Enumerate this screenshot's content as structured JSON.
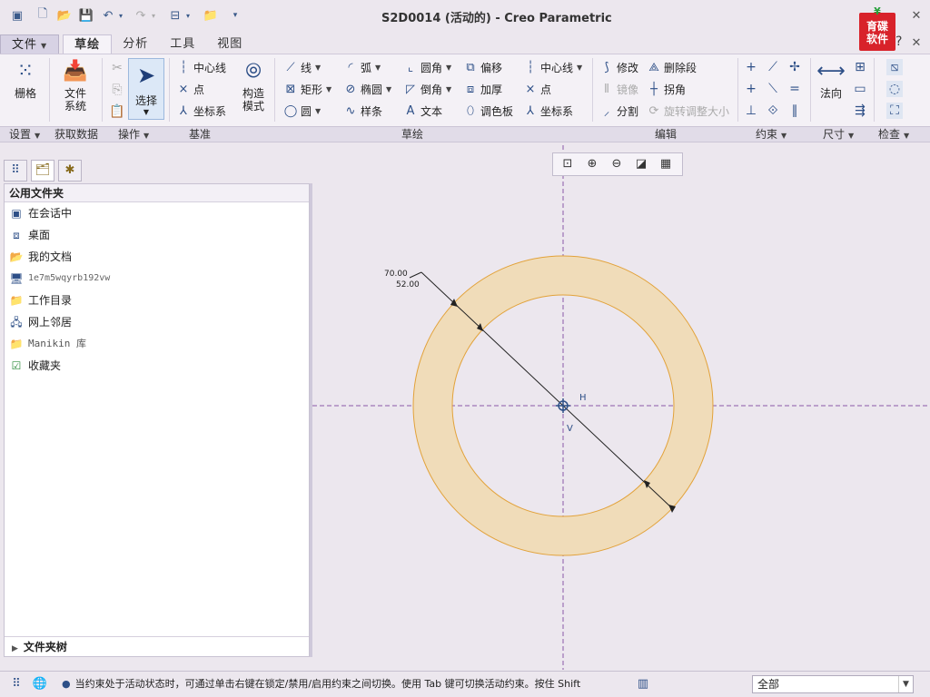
{
  "app": {
    "title": "S2D0014 (活动的) - Creo Parametric",
    "logo_text": "育碟软件",
    "help_glyph": "?"
  },
  "quick_access": [
    "new-icon",
    "open-icon",
    "save-icon",
    "undo-icon",
    "redo-icon",
    "window-icon",
    "folder-icon"
  ],
  "tabs": {
    "file": "文件",
    "items": [
      "草绘",
      "分析",
      "工具",
      "视图"
    ],
    "active": "草绘"
  },
  "ribbon": {
    "settings": {
      "grid": "栅格"
    },
    "data": {
      "file_system": [
        "文件",
        "系统"
      ]
    },
    "operations": {
      "select": "选择"
    },
    "datum": {
      "centerline": "中心线",
      "point": "点",
      "coord_sys": "坐标系",
      "construct_mode": [
        "构造",
        "模式"
      ]
    },
    "sketch": {
      "line": "线",
      "arc": "弧",
      "fillet": "圆角",
      "offset": "偏移",
      "centerline": "中心线",
      "rectangle": "矩形",
      "ellipse": "椭圆",
      "chamfer": "倒角",
      "thicken": "加厚",
      "point": "点",
      "circle": "圆",
      "spline": "样条",
      "text": "文本",
      "palette": "调色板",
      "coord_sys": "坐标系"
    },
    "edit": {
      "modify": "修改",
      "delete_segment": "删除段",
      "mirror": "镜像",
      "corner": "拐角",
      "divide": "分割",
      "rotate_resize": "旋转调整大小"
    },
    "dimension": {
      "normal": "法向"
    },
    "groups": [
      "设置",
      "获取数据",
      "操作",
      "基准",
      "草绘",
      "编辑",
      "约束",
      "尺寸",
      "检查"
    ]
  },
  "left_panel": {
    "header": "公用文件夹",
    "items": [
      {
        "label": "在会话中",
        "icon": "session-icon"
      },
      {
        "label": "桌面",
        "icon": "desktop-icon"
      },
      {
        "label": "我的文档",
        "icon": "documents-icon"
      },
      {
        "label": "1e7m5wqyrb192vw",
        "icon": "computer-icon"
      },
      {
        "label": "工作目录",
        "icon": "working-dir-icon"
      },
      {
        "label": "网上邻居",
        "icon": "network-icon"
      },
      {
        "label": "Manikin 库",
        "icon": "library-icon"
      },
      {
        "label": "收藏夹",
        "icon": "favorites-icon"
      }
    ],
    "tree": "文件夹树"
  },
  "canvas": {
    "dimension_outer": "70.00",
    "dimension_inner": "52.00",
    "label_h": "H",
    "label_v": "V",
    "ring_fill": "#f0dcb9",
    "ring_stroke": "#e2a23a"
  },
  "status": {
    "message": "当约束处于活动状态时，可通过单击右键在锁定/禁用/启用约束之间切换。使用 Tab 键可切换活动约束。按住 Shift",
    "filter": "全部"
  }
}
